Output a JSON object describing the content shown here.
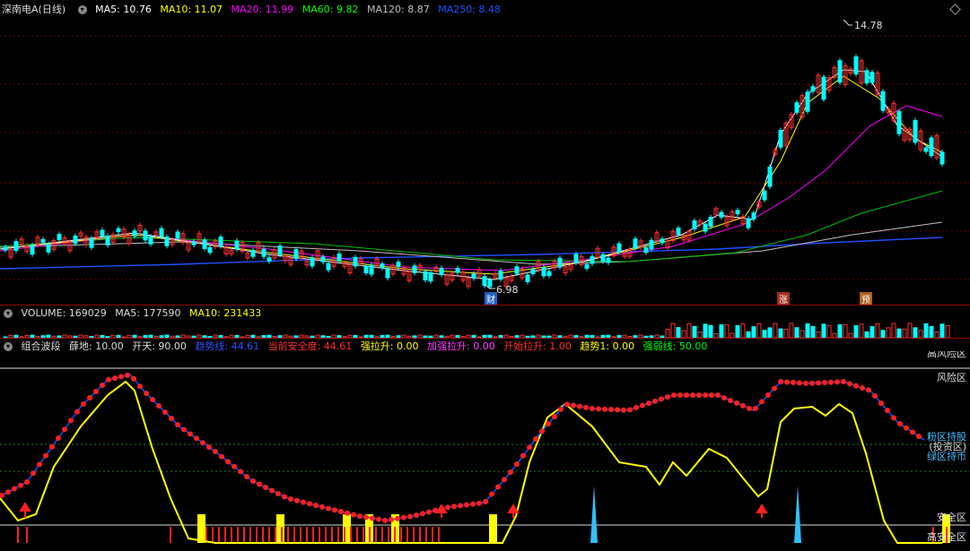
{
  "title_bar": {
    "security": "深南电A(日线)",
    "ma5": "MA5: 10.76",
    "ma10": "MA10: 11.07",
    "ma20": "MA20: 11.99",
    "ma60": "MA60: 9.82",
    "ma120": "MA120: 8.87",
    "ma250": "MA250: 8.48"
  },
  "price_panel": {
    "high_label": "14.78",
    "low_label": "6.98",
    "markers": [
      "财",
      "涨",
      "预"
    ],
    "colors": {
      "up": "#ff3030",
      "down": "#00ffff",
      "ma5": "#ffffff",
      "ma10": "#ffff00",
      "ma20": "#ff00ff",
      "ma60": "#00ff00",
      "ma120": "#c0c0c0",
      "ma250": "#2050ff"
    }
  },
  "volume_bar": {
    "title": "VOLUME: 169029",
    "ma5": "MA5: 177590",
    "ma10": "MA10: 231433"
  },
  "indicator_bar": {
    "name": "组合波段",
    "p1": "薛地: 10.00",
    "p2": "开天: 90.00",
    "trend": "趋势线: 44.61",
    "safety": "当前安全度: 44.61",
    "strong_up": "强拉升: 0.00",
    "add_up": "加强拉升: 0.00",
    "start_up": "开始拉升: 1.00",
    "trend1": "趋势1: 0.00",
    "strong_weak": "强弱线: 50.00"
  },
  "zones": {
    "high_risk": "高风险区",
    "risk": "风险区",
    "hold": "粉区持股",
    "invest": "(投资区)",
    "green_hold": "绿区持币",
    "safe": "安全区",
    "high_safe": "高安全区"
  }
}
